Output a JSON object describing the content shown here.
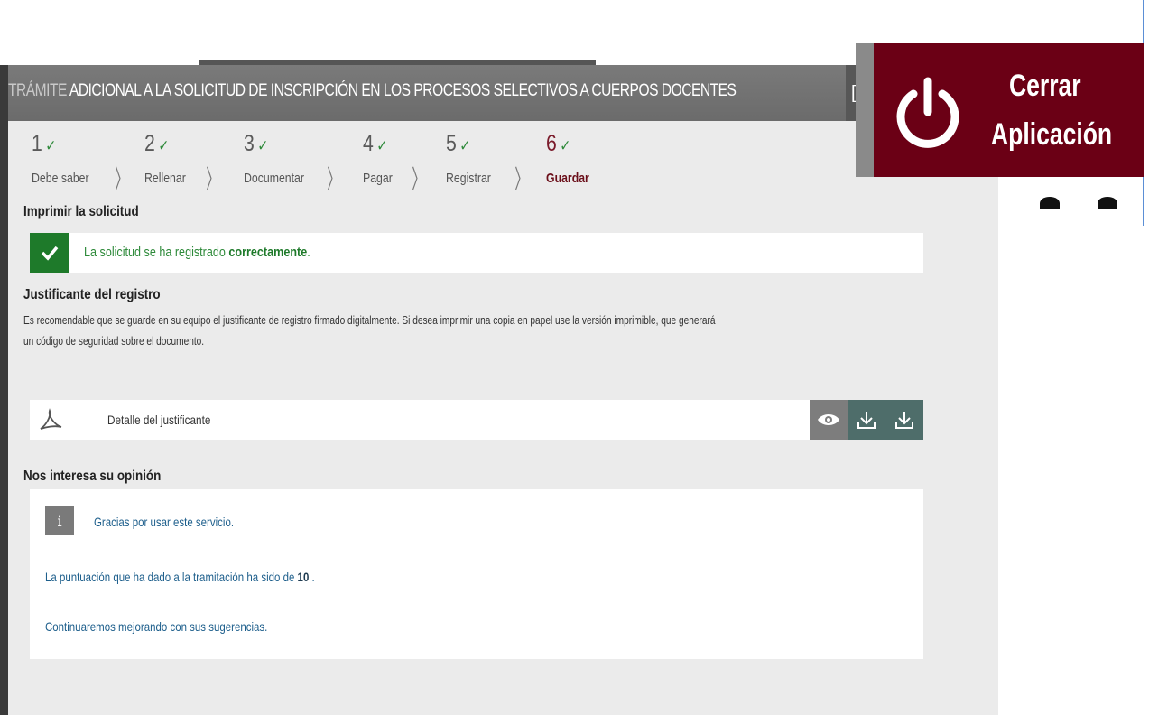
{
  "window": {
    "title_prefix": "TRÁMITE ",
    "title_rest": "ADICIONAL A LA SOLICITUD DE INSCRIPCIÓN EN LOS PROCESOS SELECTIVOS A CUERPOS DOCENTES",
    "title_cut_char": "[",
    "bg_color": "#ebebeb"
  },
  "steps": [
    {
      "num": "1",
      "check": "✓",
      "label": "Debe saber"
    },
    {
      "num": "2",
      "check": "✓",
      "label": "Rellenar"
    },
    {
      "num": "3",
      "check": "✓",
      "label": "Documentar"
    },
    {
      "num": "4",
      "check": "✓",
      "label": "Pagar"
    },
    {
      "num": "5",
      "check": "✓",
      "label": "Registrar"
    },
    {
      "num": "6",
      "check": "✓",
      "label": "Guardar"
    }
  ],
  "print": {
    "heading": "Imprimir la solicitud",
    "success_msg_pre": "La solicitud se ha registrado ",
    "success_msg_bold": "correctamente",
    "success_msg_post": "."
  },
  "receipt": {
    "heading": "Justificante del registro",
    "line1": "Es recomendable que se guarde en su equipo el justificante de registro firmado digitalmente. Si desea imprimir una copia en papel use la versión imprimible, que generará",
    "line2": "un código de seguridad sobre el documento.",
    "doc_name": "Detalle del justificante"
  },
  "opinion": {
    "heading": "Nos interesa su opinión",
    "info_icon": "i",
    "thanks": "Gracias por usar este servicio.",
    "score_pre": "La puntuación que ha dado a la tramitación ha sido de ",
    "score_value": "10",
    "score_post": " .",
    "closing": "Continuaremos mejorando con sus sugerencias."
  },
  "close_app": {
    "line1": "Cerrar",
    "line2": "Aplicación",
    "bg_color": "#6b0015"
  },
  "colors": {
    "success": "#1e7a2a",
    "active_step": "#6b0f1a",
    "download_btn": "#4e6d6a",
    "view_btn": "#7d7d7d"
  }
}
